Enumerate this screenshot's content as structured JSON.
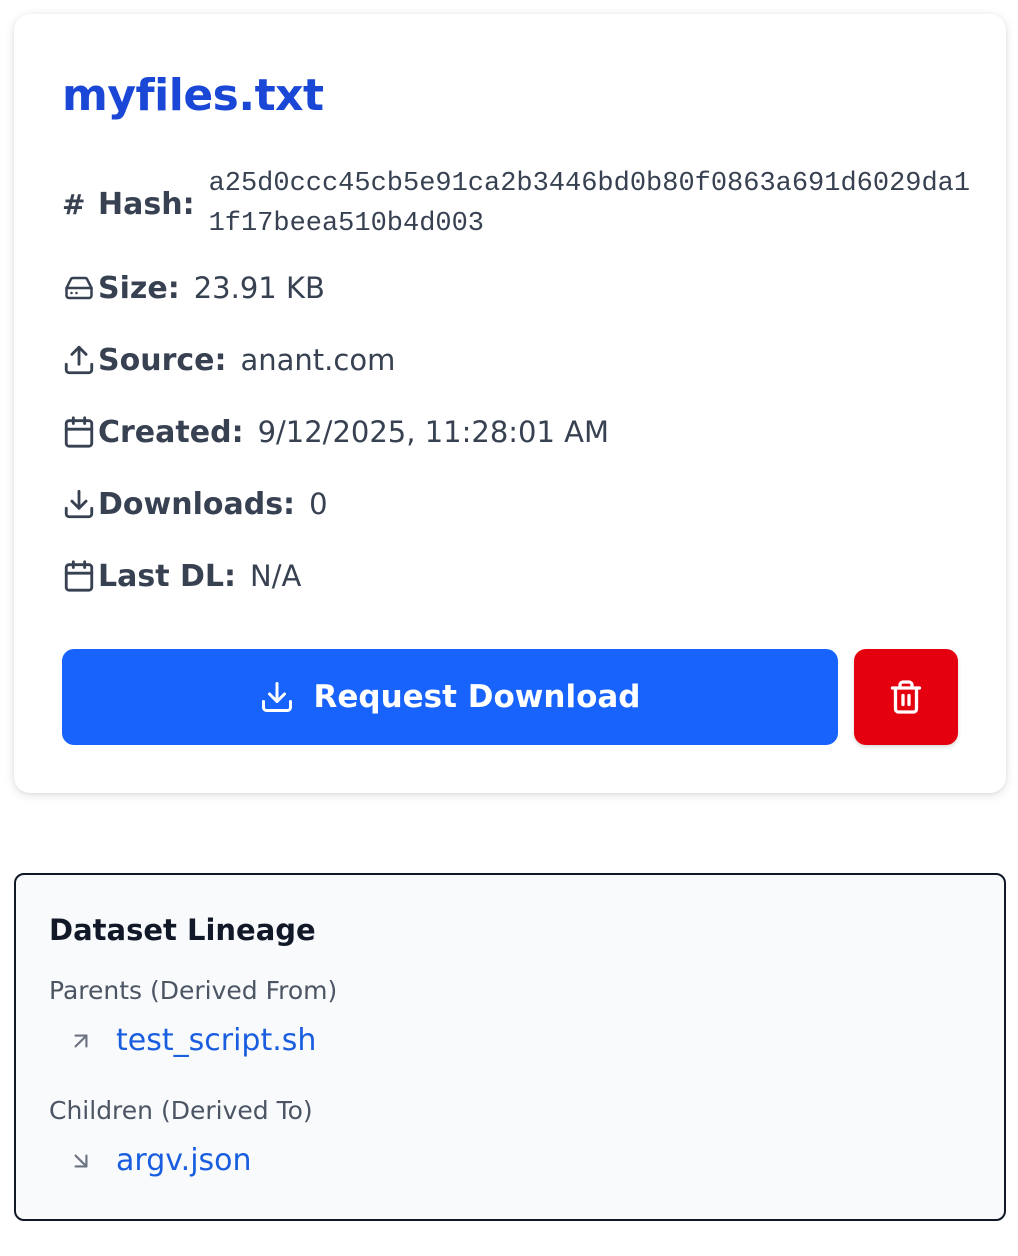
{
  "file": {
    "name": "myfiles.txt",
    "hash_label": "Hash:",
    "hash_symbol": "#",
    "hash": "a25d0ccc45cb5e91ca2b3446bd0b80f0863a691d6029da11f17beea510b4d003",
    "size_label": "Size:",
    "size": "23.91 KB",
    "source_label": "Source:",
    "source": "anant.com",
    "created_label": "Created:",
    "created": "9/12/2025, 11:28:01 AM",
    "downloads_label": "Downloads:",
    "downloads": "0",
    "last_dl_label": "Last DL:",
    "last_dl": "N/A"
  },
  "actions": {
    "request_download_label": "Request Download",
    "request_color": "#1863fb",
    "delete_color": "#e5000f"
  },
  "lineage": {
    "title": "Dataset Lineage",
    "parents_label": "Parents (Derived From)",
    "parents": [
      "test_script.sh"
    ],
    "children_label": "Children (Derived To)",
    "children": [
      "argv.json"
    ]
  },
  "icons": {
    "size": "hard-drive-icon",
    "source": "upload-icon",
    "created": "calendar-icon",
    "downloads": "download-icon",
    "last_dl": "calendar-icon",
    "delete": "trash-icon",
    "parent": "arrow-up-right-icon",
    "child": "arrow-down-right-icon"
  }
}
